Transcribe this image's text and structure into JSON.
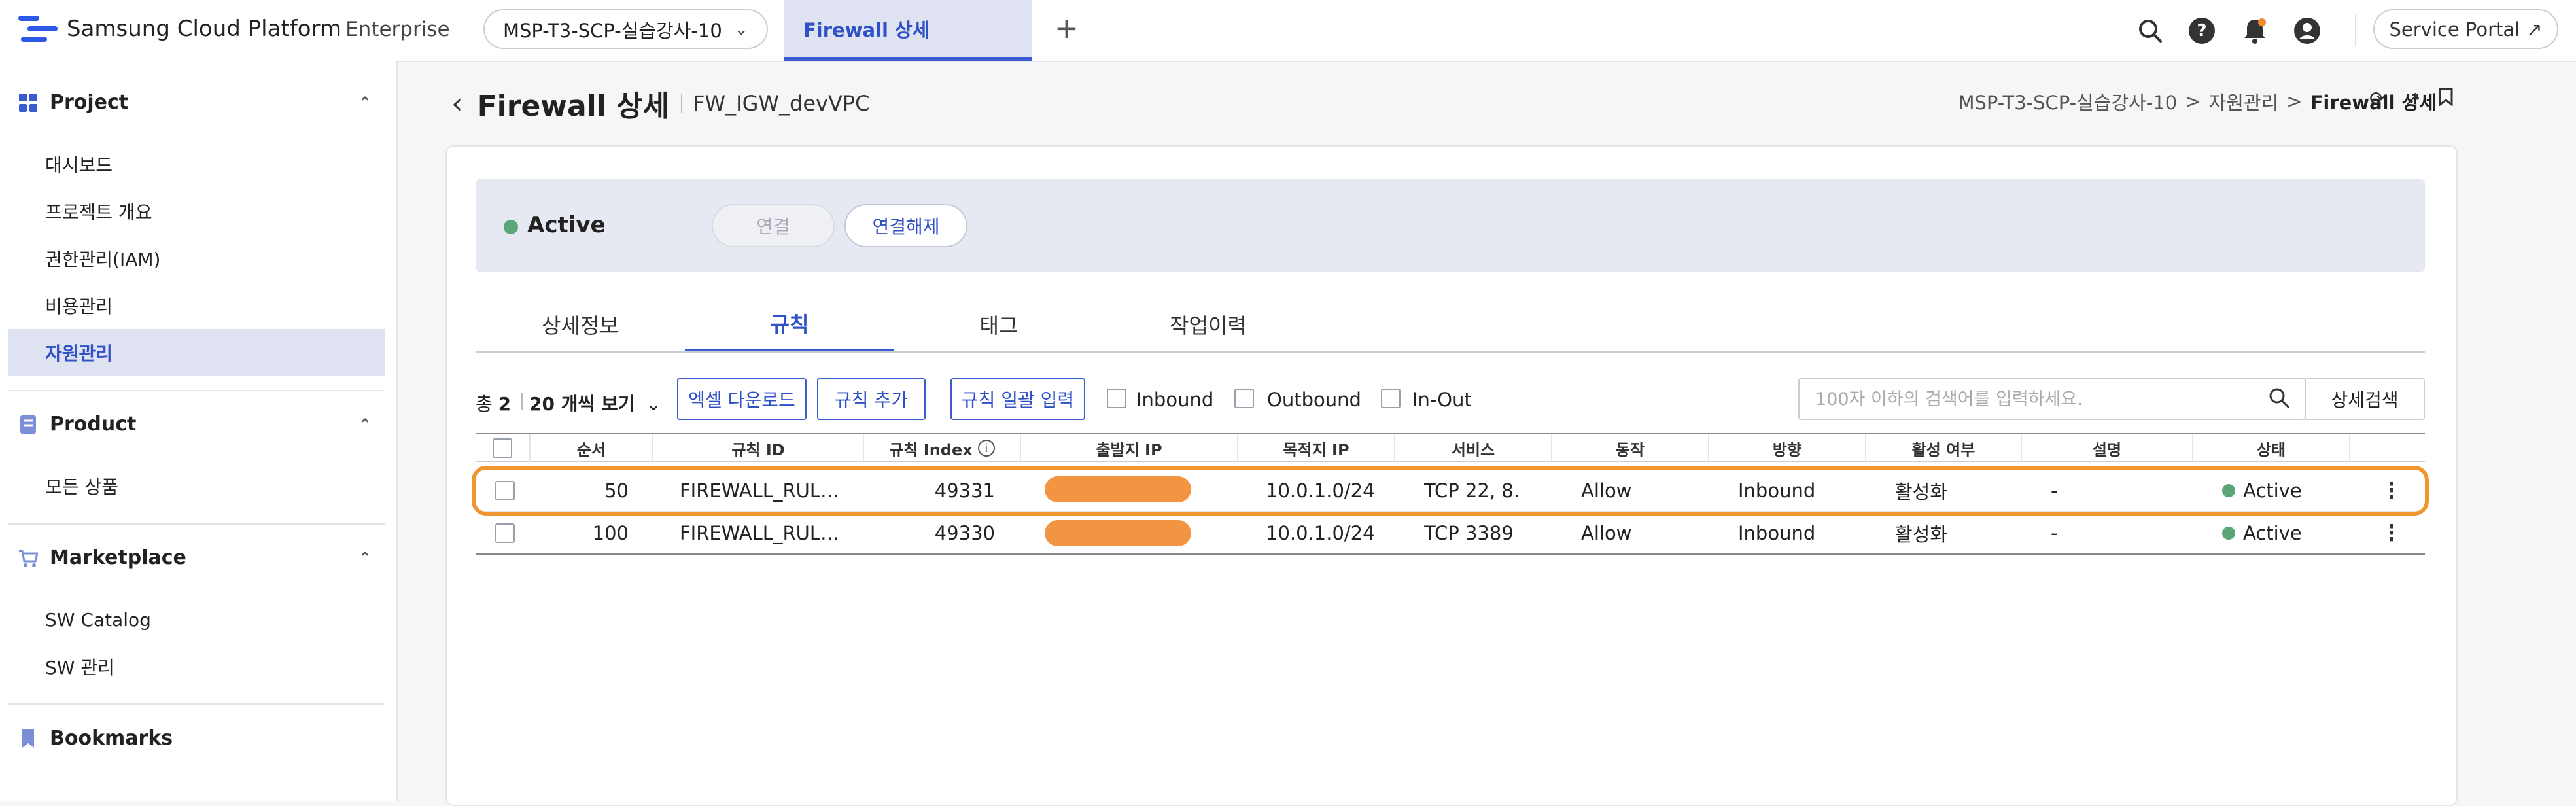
{
  "app": {
    "brand": "Samsung Cloud Platform",
    "edition": "Enterprise",
    "project_select": "MSP-T3-SCP-실습강사-10",
    "active_tab": "Firewall 상세",
    "service_portal": "Service Portal",
    "icons": [
      "search-icon",
      "help-icon",
      "notification-icon",
      "user-icon",
      "external-link-icon"
    ]
  },
  "sidebar": {
    "sections": [
      {
        "title": "Project",
        "items": [
          "대시보드",
          "프로젝트 개요",
          "권한관리(IAM)",
          "비용관리",
          "자원관리"
        ],
        "active": "자원관리"
      },
      {
        "title": "Product",
        "items": [
          "모든 상품"
        ]
      },
      {
        "title": "Marketplace",
        "items": [
          "SW Catalog",
          "SW 관리"
        ]
      },
      {
        "title": "Bookmarks",
        "items": []
      }
    ]
  },
  "page": {
    "title": "Firewall 상세",
    "subtitle": "FW_IGW_devVPC",
    "breadcrumb": [
      "MSP-T3-SCP-실습강사-10",
      "자원관리",
      "Firewall 상세"
    ]
  },
  "status": {
    "label": "Active",
    "color": "#5aa676",
    "connect": "연결",
    "disconnect": "연결해제"
  },
  "tabs": [
    "상세정보",
    "규칙",
    "태그",
    "작업이력"
  ],
  "active_tab": "규칙",
  "toolbar": {
    "total_prefix": "총",
    "total_count": "2",
    "per_page": "20 개씩 보기",
    "excel": "엑셀 다운로드",
    "add_rule": "규칙 추가",
    "bulk_input": "규칙 일괄 입력",
    "filters": [
      "Inbound",
      "Outbound",
      "In-Out"
    ],
    "search_placeholder": "100자 이하의 검색어를 입력하세요.",
    "advanced_search": "상세검색"
  },
  "table": {
    "columns": [
      "순서",
      "규칙 ID",
      "규칙 Index",
      "출발지 IP",
      "목적지 IP",
      "서비스",
      "동작",
      "방향",
      "활성 여부",
      "설명",
      "상태"
    ],
    "rows": [
      {
        "order": "50",
        "rule_id": "FIREWALL_RUL…",
        "index": "49331",
        "src_ip": "",
        "dst_ip": "10.0.1.0/24",
        "service": "TCP 22, 8…",
        "action": "Allow",
        "direction": "Inbound",
        "enabled": "활성화",
        "desc": "-",
        "state": "Active"
      },
      {
        "order": "100",
        "rule_id": "FIREWALL_RUL…",
        "index": "49330",
        "src_ip": "",
        "dst_ip": "10.0.1.0/24",
        "service": "TCP 3389",
        "action": "Allow",
        "direction": "Inbound",
        "enabled": "활성화",
        "desc": "-",
        "state": "Active"
      }
    ]
  },
  "colors": {
    "accent": "#3a5ad1",
    "active_bg": "#dfe3f1",
    "annotation": "#f0962e"
  }
}
